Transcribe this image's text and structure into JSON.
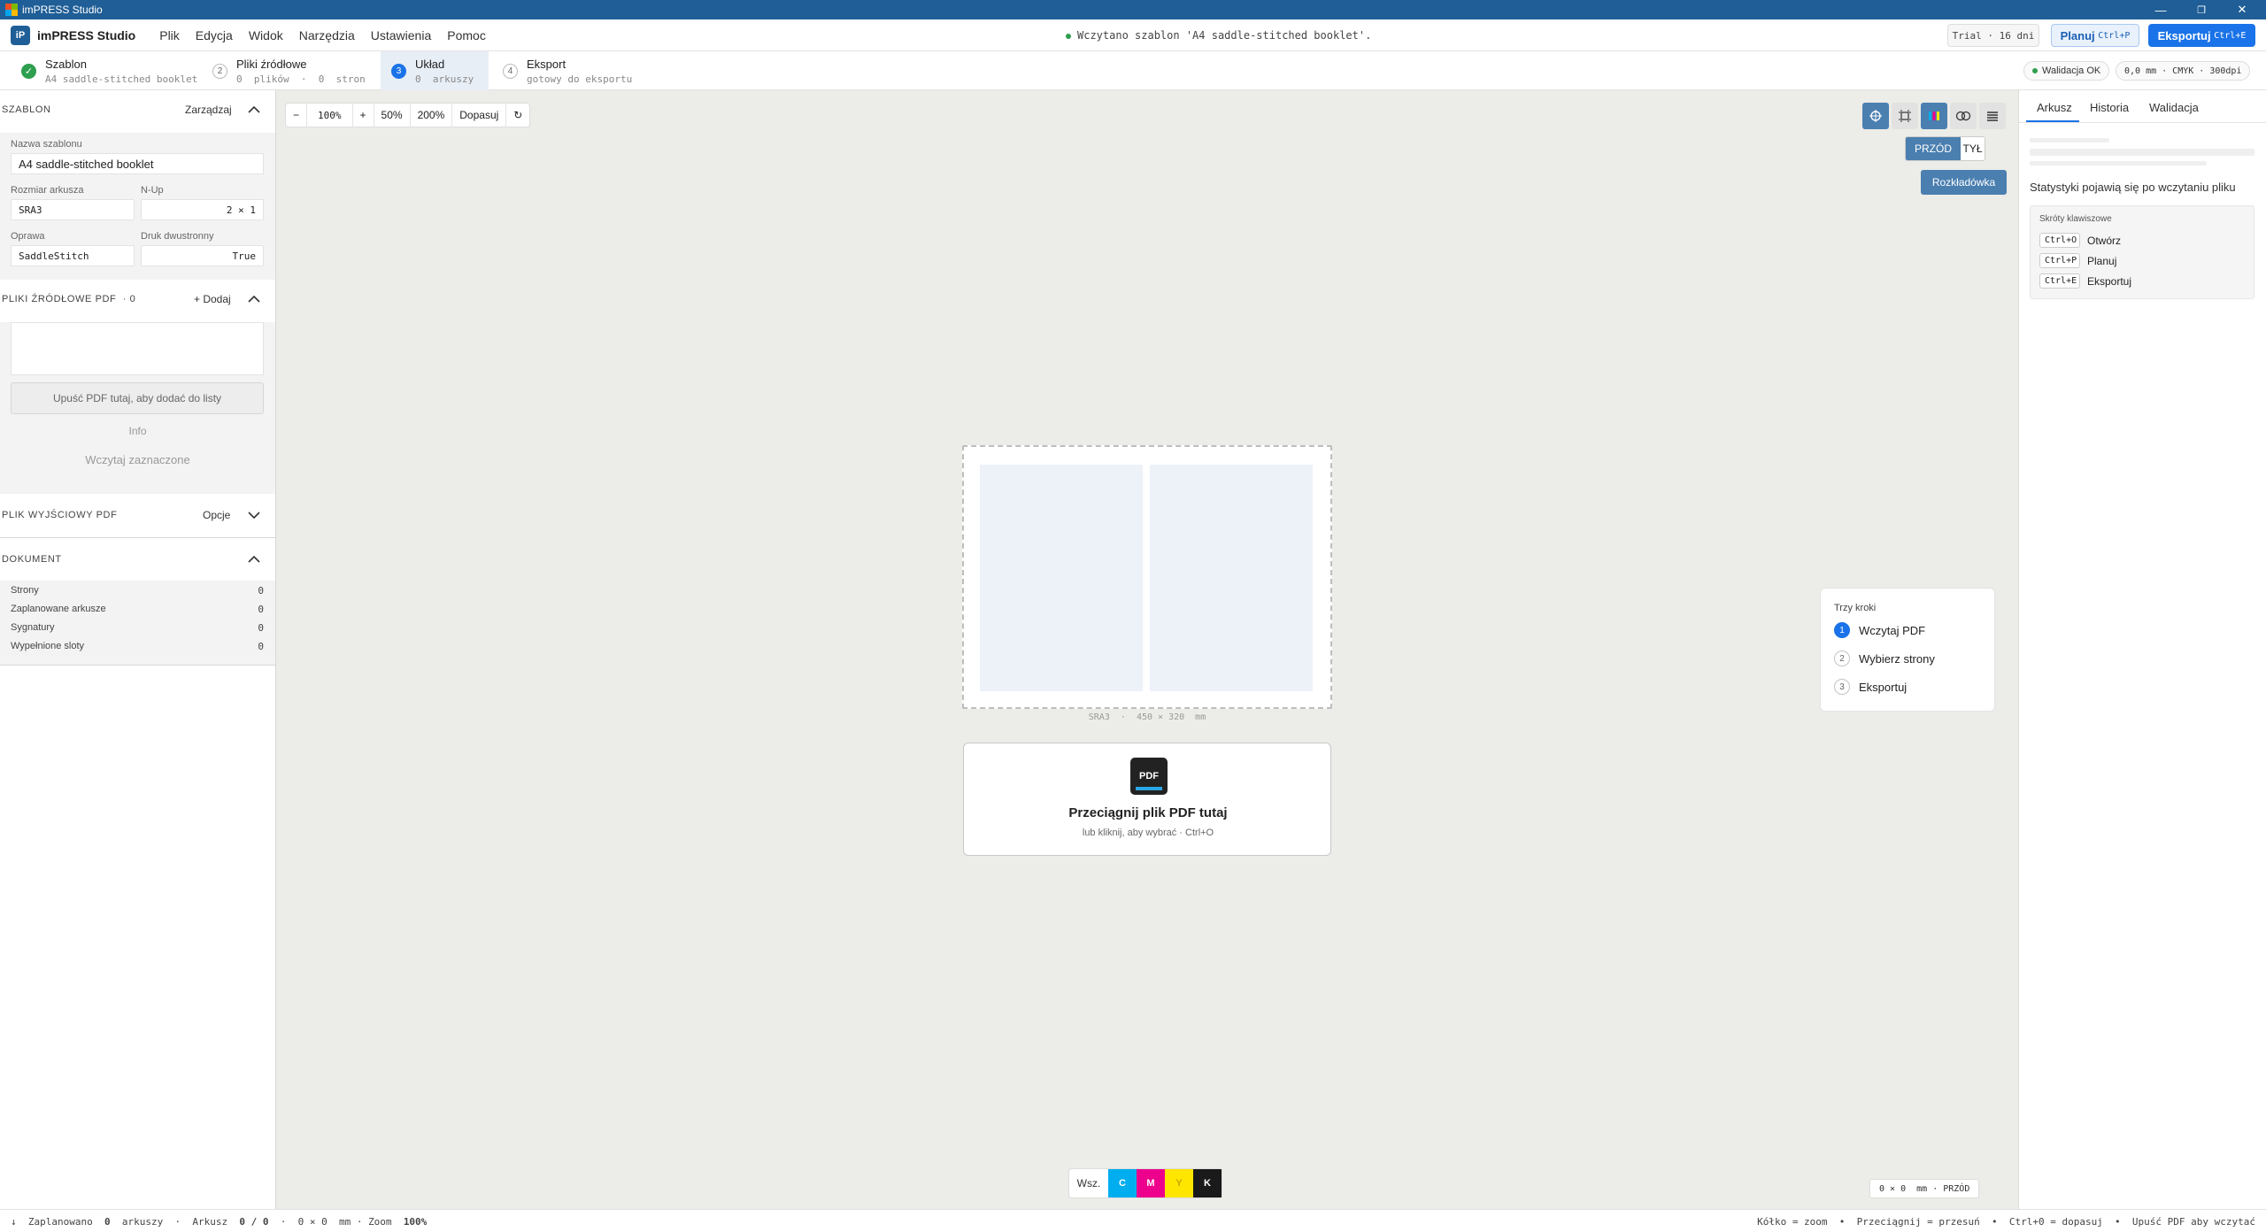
{
  "titlebar": {
    "title": "imPRESS Studio",
    "minimize": "—",
    "maximize": "❐",
    "close": "✕"
  },
  "menubar": {
    "logo": "iP",
    "app_name": "imPRESS Studio",
    "items": [
      "Plik",
      "Edycja",
      "Widok",
      "Narzędzia",
      "Ustawienia",
      "Pomoc"
    ],
    "status_message": "Wczytano szablon 'A4 saddle-stitched booklet'.",
    "trial": "Trial · 16 dni",
    "plan_label": "Planuj",
    "plan_shortcut": "Ctrl+P",
    "export_label": "Eksportuj",
    "export_shortcut": "Ctrl+E"
  },
  "steps": [
    {
      "num": "✓",
      "title": "Szablon",
      "sub": "A4 saddle-stitched booklet"
    },
    {
      "num": "2",
      "title": "Pliki źródłowe",
      "sub": "0  plików  ·  0  stron"
    },
    {
      "num": "3",
      "title": "Układ",
      "sub": "0  arkuszy"
    },
    {
      "num": "4",
      "title": "Eksport",
      "sub": "gotowy do eksportu"
    }
  ],
  "validation_chip": "Walidacja OK",
  "info_chip": "0,0 mm · CMYK · 300dpi",
  "left": {
    "template": {
      "title": "SZABLON",
      "action": "Zarządzaj",
      "name_label": "Nazwa szablonu",
      "name_value": "A4 saddle-stitched booklet",
      "size_label": "Rozmiar arkusza",
      "size_value": "SRA3",
      "nup_label": "N-Up",
      "nup_value": "2 × 1",
      "binding_label": "Oprawa",
      "binding_value": "SaddleStitch",
      "duplex_label": "Druk dwustronny",
      "duplex_value": "True"
    },
    "sources": {
      "title": "PLIKI ŹRÓDŁOWE PDF",
      "count": "· 0",
      "action": "+ Dodaj",
      "drop_hint": "Upuść PDF tutaj, aby dodać do listy",
      "info": "Info",
      "load_selected": "Wczytaj zaznaczone"
    },
    "output": {
      "title": "PLIK WYJŚCIOWY PDF",
      "action": "Opcje"
    },
    "document": {
      "title": "DOKUMENT",
      "rows": [
        {
          "label": "Strony",
          "value": "0"
        },
        {
          "label": "Zaplanowane arkusze",
          "value": "0"
        },
        {
          "label": "Sygnatury",
          "value": "0"
        },
        {
          "label": "Wypełnione sloty",
          "value": "0"
        }
      ]
    }
  },
  "canvas": {
    "zoom": {
      "minus": "−",
      "value": "100%",
      "plus": "+",
      "z50": "50%",
      "z200": "200%",
      "fit": "Dopasuj",
      "reset": "↻"
    },
    "front": "PRZÓD",
    "back": "TYŁ",
    "spread": "Rozkładówka",
    "sheet_caption": "SRA3  ·  450 × 320  mm",
    "drop_title": "Przeciągnij plik PDF tutaj",
    "drop_sub": "lub kliknij, aby wybrać · Ctrl+O",
    "pdf_icon_label": "PDF",
    "three_steps": {
      "title": "Trzy kroki",
      "items": [
        {
          "num": "1",
          "label": "Wczytaj PDF"
        },
        {
          "num": "2",
          "label": "Wybierz strony"
        },
        {
          "num": "3",
          "label": "Eksportuj"
        }
      ]
    },
    "plates": {
      "all": "Wsz.",
      "c": "C",
      "m": "M",
      "y": "Y",
      "k": "K"
    },
    "coords": "0 × 0  mm · PRZÓD"
  },
  "right": {
    "tabs": [
      "Arkusz",
      "Historia",
      "Walidacja"
    ],
    "stats_hint": "Statystyki pojawią się po wczytaniu pliku",
    "shortcuts": {
      "title": "Skróty klawiszowe",
      "items": [
        {
          "key": "Ctrl+O",
          "label": "Otwórz"
        },
        {
          "key": "Ctrl+P",
          "label": "Planuj"
        },
        {
          "key": "Ctrl+E",
          "label": "Eksportuj"
        }
      ]
    }
  },
  "statusbar": {
    "left_icon": "↓",
    "planned_label": "Zaplanowano",
    "planned_value": "0",
    "sheets_label": "arkuszy",
    "sheet_label": "Arkusz",
    "sheet_value": "0 / 0",
    "dims": "0 × 0  mm · Zoom",
    "zoom_value": "100%",
    "hints": "Kółko = zoom  •  Przeciągnij = przesuń  •  Ctrl+0 = dopasuj  •  Upuść PDF aby wczytać"
  },
  "colors": {
    "accent": "#1f5e96",
    "primary_button": "#1a73e8",
    "active_tool": "#4a7fb0",
    "cyan": "#00aeef",
    "magenta": "#ec008c",
    "yellow": "#ffe600",
    "black": "#1a1a1a"
  }
}
